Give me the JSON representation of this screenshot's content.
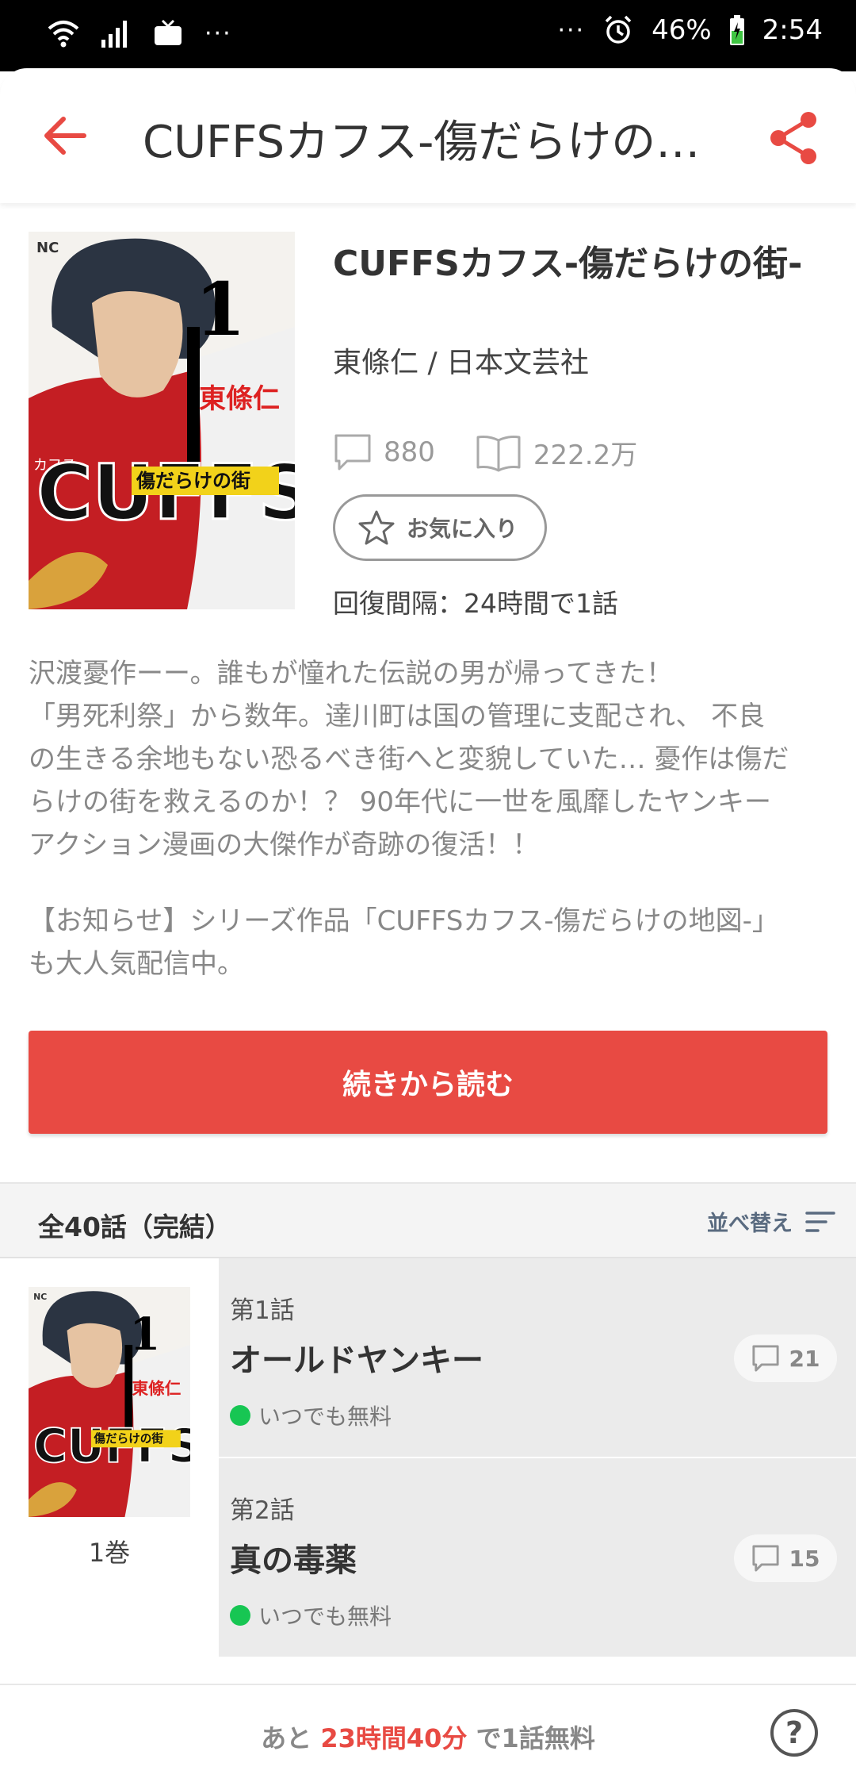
{
  "status_bar": {
    "more_left": "···",
    "more_right": "···",
    "battery": "46%",
    "time": "2:54"
  },
  "app_bar": {
    "title": "CUFFSカフス-傷だらけの…"
  },
  "book": {
    "title": "CUFFSカフス-傷だらけの街-",
    "author_publisher": "東條仁 / 日本文芸社",
    "comment_count": "880",
    "view_count": "222.2万",
    "favorite_label": "お気に入り",
    "recovery": "回復間隔：24時間で1話",
    "cover_text": {
      "nc": "NC",
      "author": "東條仁",
      "series": "CUFFS",
      "subtitle": "傷だらけの街",
      "volume": "1",
      "kana": "カフス"
    },
    "description": [
      "沢渡憂作ーー。誰もが憧れた伝説の男が帰ってきた！",
      "「男死利祭」から数年。達川町は国の管理に支配され、 不良",
      "の生きる余地もない恐るべき街へと変貌していた… 憂作は傷だ",
      "らけの街を救えるのか！？ 90年代に一世を風靡したヤンキー",
      "アクション漫画の大傑作が奇跡の復活！！"
    ],
    "notice": [
      "【お知らせ】シリーズ作品「CUFFSカフス-傷だらけの地図-」",
      "も大人気配信中。"
    ],
    "read_button": "続きから読む"
  },
  "list": {
    "count_label": "全40話（完結）",
    "sort_label": "並べ替え",
    "volume_label": "1巻",
    "episodes": [
      {
        "number": "第1話",
        "title": "オールドヤンキー",
        "badge": "いつでも無料",
        "comments": "21"
      },
      {
        "number": "第2話",
        "title": "真の毒薬",
        "badge": "いつでも無料",
        "comments": "15"
      }
    ]
  },
  "bottom_bar": {
    "prefix": "あと ",
    "time": "23時間40分",
    "suffix": " で1話無料",
    "help": "?"
  },
  "colors": {
    "accent": "#e84a43",
    "free_dot": "#17c653",
    "status_bar": "#000000"
  },
  "icons": [
    "wifi-icon",
    "signal-icon",
    "tv-icon",
    "alarm-icon",
    "battery-icon",
    "back-arrow-icon",
    "share-icon",
    "comment-icon",
    "book-icon",
    "star-icon",
    "sort-icon",
    "help-icon"
  ]
}
